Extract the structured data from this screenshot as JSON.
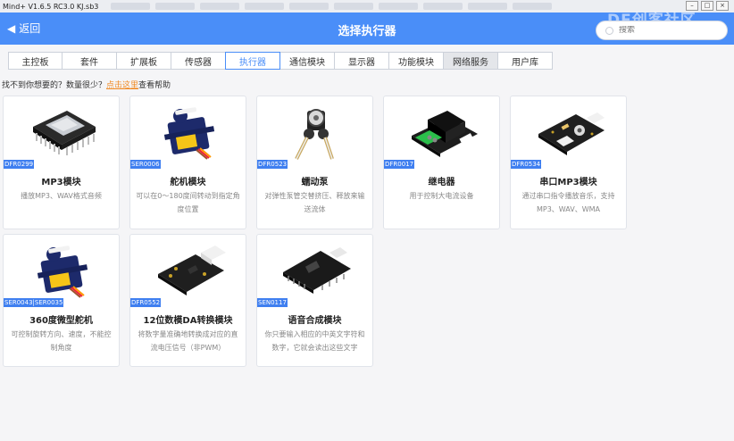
{
  "window": {
    "title": "Mind+ V1.6.5 RC3.0  KJ.sb3",
    "buttons": [
      "–",
      "□",
      "×"
    ]
  },
  "header": {
    "back_label": "返回",
    "title": "选择执行器",
    "search_placeholder": "搜索",
    "logo": "DF创客社区"
  },
  "tabs": [
    {
      "label": "主控板"
    },
    {
      "label": "套件"
    },
    {
      "label": "扩展板"
    },
    {
      "label": "传感器"
    },
    {
      "label": "执行器"
    },
    {
      "label": "通信模块"
    },
    {
      "label": "显示器"
    },
    {
      "label": "功能模块"
    },
    {
      "label": "网络服务"
    },
    {
      "label": "用户库"
    }
  ],
  "hint": {
    "prefix": "找不到你想要的？数量很少？",
    "link": "点击这里",
    "suffix": "查看帮助"
  },
  "cards": [
    {
      "code": "DFR0299",
      "name": "MP3模块",
      "desc": "播放MP3、WAV格式音频",
      "icon": "mp3-module-icon"
    },
    {
      "code": "SER0006",
      "name": "舵机模块",
      "desc": "可以在0～180度间转动到指定角度位置",
      "icon": "servo-icon"
    },
    {
      "code": "DFR0523",
      "name": "蠕动泵",
      "desc": "对弹性泵管交替挤压、释放来输送流体",
      "icon": "peristaltic-pump-icon"
    },
    {
      "code": "DFR0017",
      "name": "继电器",
      "desc": "用于控制大电流设备",
      "icon": "relay-icon"
    },
    {
      "code": "DFR0534",
      "name": "串口MP3模块",
      "desc": "通过串口指令播放音乐，支持MP3、WAV、WMA",
      "icon": "serial-mp3-icon"
    },
    {
      "code": "SER0043|SER0035",
      "name": "360度微型舵机",
      "desc": "可控制旋转方向、速度，不能控制角度",
      "icon": "micro-servo-icon"
    },
    {
      "code": "DFR0552",
      "name": "12位数模DA转换模块",
      "desc": "将数字量准确地转换成对应的直流电压信号（非PWM）",
      "icon": "dac-module-icon"
    },
    {
      "code": "SEN0117",
      "name": "语音合成模块",
      "desc": "你只要输入相应的中英文字符和数字，它就会读出这些文字",
      "icon": "speech-synthesis-icon"
    }
  ]
}
